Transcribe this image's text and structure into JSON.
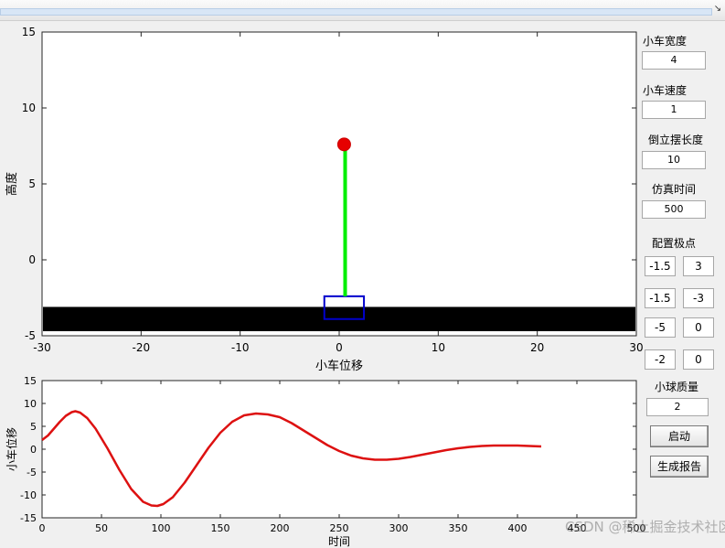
{
  "window": {
    "dock_glyph": "↘"
  },
  "top_axes": {
    "xlabel": "小车位移",
    "ylabel": "高度",
    "xticks": [
      "-30",
      "-20",
      "-10",
      "0",
      "10",
      "20",
      "30"
    ],
    "yticks": [
      "-5",
      "0",
      "5",
      "10",
      "15"
    ],
    "xlim": [
      -30,
      30
    ],
    "ylim": [
      -5,
      15
    ],
    "ground": {
      "y_top": -3.1,
      "y_bottom": -4.7
    },
    "cart": {
      "x_left": -1.5,
      "x_right": 2.5,
      "y_bottom": -3.9,
      "y_top": -2.4
    },
    "pendulum": {
      "x": 0.6,
      "y_base": -2.4,
      "y_tip": 7.7
    },
    "ball": {
      "x": 0.5,
      "y": 7.6
    },
    "colors": {
      "ground": "#000000",
      "cart": "#0000cc",
      "rod": "#00ee00",
      "ball": "#e60000",
      "ball_edge": "#cc0000"
    }
  },
  "bottom_axes": {
    "xlabel": "时间",
    "ylabel": "小车位移",
    "xticks": [
      "0",
      "50",
      "100",
      "150",
      "200",
      "250",
      "300",
      "350",
      "400",
      "450",
      "500"
    ],
    "yticks": [
      "-15",
      "-10",
      "-5",
      "0",
      "5",
      "10",
      "15"
    ],
    "xlim": [
      0,
      500
    ],
    "ylim": [
      -15,
      15
    ],
    "line_color": "#dd1111"
  },
  "chart_data": {
    "type": "line",
    "xlabel": "时间",
    "ylabel": "小车位移",
    "xlim": [
      0,
      500
    ],
    "ylim": [
      -15,
      15
    ],
    "series": [
      {
        "x": [
          0,
          5,
          10,
          15,
          20,
          25,
          28,
          32,
          38,
          45,
          55,
          65,
          75,
          85,
          92,
          97,
          102,
          110,
          120,
          130,
          140,
          150,
          160,
          170,
          180,
          190,
          200,
          210,
          220,
          230,
          240,
          250,
          260,
          270,
          280,
          290,
          300,
          310,
          320,
          330,
          340,
          350,
          360,
          370,
          380,
          390,
          400,
          410,
          420
        ],
        "values": [
          2.0,
          3.0,
          4.5,
          6.0,
          7.3,
          8.1,
          8.3,
          8.0,
          6.8,
          4.5,
          0.2,
          -4.5,
          -8.7,
          -11.5,
          -12.3,
          -12.4,
          -12.0,
          -10.5,
          -7.3,
          -3.5,
          0.3,
          3.6,
          6.0,
          7.4,
          7.8,
          7.6,
          7.0,
          5.7,
          4.1,
          2.5,
          0.9,
          -0.4,
          -1.4,
          -2.0,
          -2.3,
          -2.3,
          -2.1,
          -1.7,
          -1.2,
          -0.7,
          -0.2,
          0.2,
          0.5,
          0.7,
          0.8,
          0.8,
          0.8,
          0.7,
          0.6
        ]
      }
    ]
  },
  "side_panel": {
    "cart_width_label": "小车宽度",
    "cart_width_value": "4",
    "cart_speed_label": "小车速度",
    "cart_speed_value": "1",
    "pendulum_length_label": "倒立摆长度",
    "pendulum_length_value": "10",
    "sim_time_label": "仿真时间",
    "sim_time_value": "500",
    "poles_label": "配置极点",
    "poles": [
      [
        "-1.5",
        "3"
      ],
      [
        "-1.5",
        "-3"
      ],
      [
        "-5",
        "0"
      ],
      [
        "-2",
        "0"
      ]
    ],
    "ball_mass_label": "小球质量",
    "ball_mass_value": "2",
    "start_button": "启动",
    "report_button": "生成报告"
  },
  "watermark": "CSDN @稀土掘金技术社区"
}
